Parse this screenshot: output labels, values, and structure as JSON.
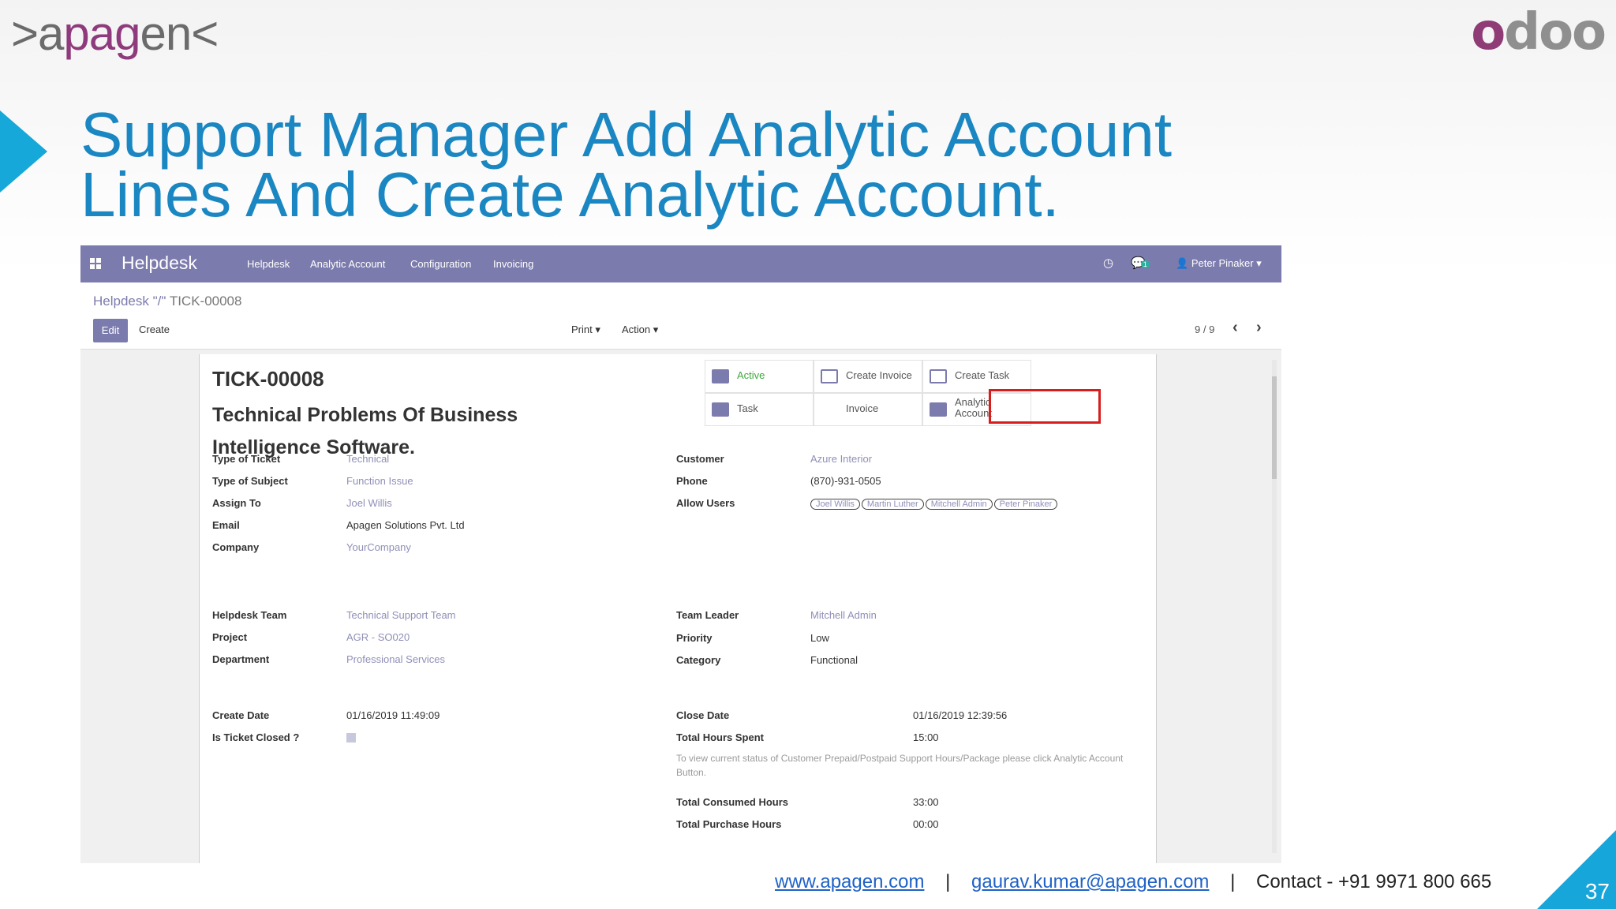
{
  "slide": {
    "logo_left": ">apagen<",
    "logo_right": "odoo",
    "title_line1": "Support Manager Add Analytic Account",
    "title_line2": "Lines And Create Analytic Account.",
    "page_number": "37",
    "footer": {
      "website": "www.apagen.com",
      "email": "gaurav.kumar@apagen.com",
      "contact": "Contact - +91 9971 800 665"
    },
    "accent_color": "#16a8d8",
    "title_color": "#1a87c2"
  },
  "app": {
    "brand": "Helpdesk",
    "menu": [
      "Helpdesk",
      "Analytic Account",
      "Configuration",
      "Invoicing"
    ],
    "user": "Peter Pinaker",
    "chat_badge": "1",
    "topbar_color": "#7c7bad"
  },
  "control": {
    "breadcrumb_link": "Helpdesk \"/\"",
    "breadcrumb_current": "TICK-00008",
    "edit_label": "Edit",
    "create_label": "Create",
    "print_label": "Print",
    "action_label": "Action",
    "pager": "9 / 9"
  },
  "ticket": {
    "code": "TICK-00008",
    "title": "Technical Problems Of Business Intelligence Software.",
    "smart_buttons": {
      "active": "Active",
      "create_invoice": "Create Invoice",
      "create_task": "Create Task",
      "task": "Task",
      "invoice": "Invoice",
      "analytic_account": "Analytic Account"
    },
    "labels": {
      "type_of_ticket": "Type of Ticket",
      "type_of_subject": "Type of Subject",
      "assign_to": "Assign To",
      "email": "Email",
      "company": "Company",
      "customer": "Customer",
      "phone": "Phone",
      "allow_users": "Allow Users",
      "helpdesk_team": "Helpdesk Team",
      "project": "Project",
      "department": "Department",
      "team_leader": "Team Leader",
      "priority": "Priority",
      "category": "Category",
      "create_date": "Create Date",
      "is_ticket_closed": "Is Ticket Closed ?",
      "close_date": "Close Date",
      "total_hours_spent": "Total Hours Spent",
      "total_consumed_hours": "Total Consumed Hours",
      "total_purchase_hours": "Total Purchase Hours"
    },
    "values": {
      "type_of_ticket": "Technical",
      "type_of_subject": "Function Issue",
      "assign_to": "Joel Willis",
      "email": "Apagen Solutions Pvt. Ltd",
      "company": "YourCompany",
      "customer": "Azure Interior",
      "phone": "(870)-931-0505",
      "allow_users": [
        "Joel Willis",
        "Martin Luther",
        "Mitchell Admin",
        "Peter Pinaker"
      ],
      "helpdesk_team": "Technical Support Team",
      "project": "AGR - SO020",
      "department": "Professional Services",
      "team_leader": "Mitchell Admin",
      "priority": "Low",
      "category": "Functional",
      "create_date": "01/16/2019 11:49:09",
      "close_date": "01/16/2019 12:39:56",
      "total_hours_spent": "15:00",
      "note": "To view current status of Customer Prepaid/Postpaid Support Hours/Package please click Analytic Account Button.",
      "total_consumed_hours": "33:00",
      "total_purchase_hours": "00:00"
    }
  }
}
